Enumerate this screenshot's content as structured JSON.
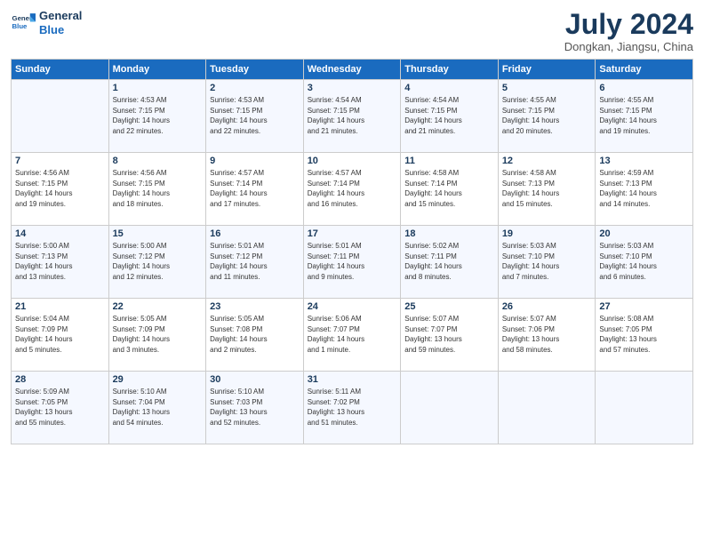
{
  "header": {
    "logo_line1": "General",
    "logo_line2": "Blue",
    "month": "July 2024",
    "location": "Dongkan, Jiangsu, China"
  },
  "weekdays": [
    "Sunday",
    "Monday",
    "Tuesday",
    "Wednesday",
    "Thursday",
    "Friday",
    "Saturday"
  ],
  "weeks": [
    [
      {
        "day": "",
        "info": ""
      },
      {
        "day": "1",
        "info": "Sunrise: 4:53 AM\nSunset: 7:15 PM\nDaylight: 14 hours\nand 22 minutes."
      },
      {
        "day": "2",
        "info": "Sunrise: 4:53 AM\nSunset: 7:15 PM\nDaylight: 14 hours\nand 22 minutes."
      },
      {
        "day": "3",
        "info": "Sunrise: 4:54 AM\nSunset: 7:15 PM\nDaylight: 14 hours\nand 21 minutes."
      },
      {
        "day": "4",
        "info": "Sunrise: 4:54 AM\nSunset: 7:15 PM\nDaylight: 14 hours\nand 21 minutes."
      },
      {
        "day": "5",
        "info": "Sunrise: 4:55 AM\nSunset: 7:15 PM\nDaylight: 14 hours\nand 20 minutes."
      },
      {
        "day": "6",
        "info": "Sunrise: 4:55 AM\nSunset: 7:15 PM\nDaylight: 14 hours\nand 19 minutes."
      }
    ],
    [
      {
        "day": "7",
        "info": "Sunrise: 4:56 AM\nSunset: 7:15 PM\nDaylight: 14 hours\nand 19 minutes."
      },
      {
        "day": "8",
        "info": "Sunrise: 4:56 AM\nSunset: 7:15 PM\nDaylight: 14 hours\nand 18 minutes."
      },
      {
        "day": "9",
        "info": "Sunrise: 4:57 AM\nSunset: 7:14 PM\nDaylight: 14 hours\nand 17 minutes."
      },
      {
        "day": "10",
        "info": "Sunrise: 4:57 AM\nSunset: 7:14 PM\nDaylight: 14 hours\nand 16 minutes."
      },
      {
        "day": "11",
        "info": "Sunrise: 4:58 AM\nSunset: 7:14 PM\nDaylight: 14 hours\nand 15 minutes."
      },
      {
        "day": "12",
        "info": "Sunrise: 4:58 AM\nSunset: 7:13 PM\nDaylight: 14 hours\nand 15 minutes."
      },
      {
        "day": "13",
        "info": "Sunrise: 4:59 AM\nSunset: 7:13 PM\nDaylight: 14 hours\nand 14 minutes."
      }
    ],
    [
      {
        "day": "14",
        "info": "Sunrise: 5:00 AM\nSunset: 7:13 PM\nDaylight: 14 hours\nand 13 minutes."
      },
      {
        "day": "15",
        "info": "Sunrise: 5:00 AM\nSunset: 7:12 PM\nDaylight: 14 hours\nand 12 minutes."
      },
      {
        "day": "16",
        "info": "Sunrise: 5:01 AM\nSunset: 7:12 PM\nDaylight: 14 hours\nand 11 minutes."
      },
      {
        "day": "17",
        "info": "Sunrise: 5:01 AM\nSunset: 7:11 PM\nDaylight: 14 hours\nand 9 minutes."
      },
      {
        "day": "18",
        "info": "Sunrise: 5:02 AM\nSunset: 7:11 PM\nDaylight: 14 hours\nand 8 minutes."
      },
      {
        "day": "19",
        "info": "Sunrise: 5:03 AM\nSunset: 7:10 PM\nDaylight: 14 hours\nand 7 minutes."
      },
      {
        "day": "20",
        "info": "Sunrise: 5:03 AM\nSunset: 7:10 PM\nDaylight: 14 hours\nand 6 minutes."
      }
    ],
    [
      {
        "day": "21",
        "info": "Sunrise: 5:04 AM\nSunset: 7:09 PM\nDaylight: 14 hours\nand 5 minutes."
      },
      {
        "day": "22",
        "info": "Sunrise: 5:05 AM\nSunset: 7:09 PM\nDaylight: 14 hours\nand 3 minutes."
      },
      {
        "day": "23",
        "info": "Sunrise: 5:05 AM\nSunset: 7:08 PM\nDaylight: 14 hours\nand 2 minutes."
      },
      {
        "day": "24",
        "info": "Sunrise: 5:06 AM\nSunset: 7:07 PM\nDaylight: 14 hours\nand 1 minute."
      },
      {
        "day": "25",
        "info": "Sunrise: 5:07 AM\nSunset: 7:07 PM\nDaylight: 13 hours\nand 59 minutes."
      },
      {
        "day": "26",
        "info": "Sunrise: 5:07 AM\nSunset: 7:06 PM\nDaylight: 13 hours\nand 58 minutes."
      },
      {
        "day": "27",
        "info": "Sunrise: 5:08 AM\nSunset: 7:05 PM\nDaylight: 13 hours\nand 57 minutes."
      }
    ],
    [
      {
        "day": "28",
        "info": "Sunrise: 5:09 AM\nSunset: 7:05 PM\nDaylight: 13 hours\nand 55 minutes."
      },
      {
        "day": "29",
        "info": "Sunrise: 5:10 AM\nSunset: 7:04 PM\nDaylight: 13 hours\nand 54 minutes."
      },
      {
        "day": "30",
        "info": "Sunrise: 5:10 AM\nSunset: 7:03 PM\nDaylight: 13 hours\nand 52 minutes."
      },
      {
        "day": "31",
        "info": "Sunrise: 5:11 AM\nSunset: 7:02 PM\nDaylight: 13 hours\nand 51 minutes."
      },
      {
        "day": "",
        "info": ""
      },
      {
        "day": "",
        "info": ""
      },
      {
        "day": "",
        "info": ""
      }
    ]
  ]
}
